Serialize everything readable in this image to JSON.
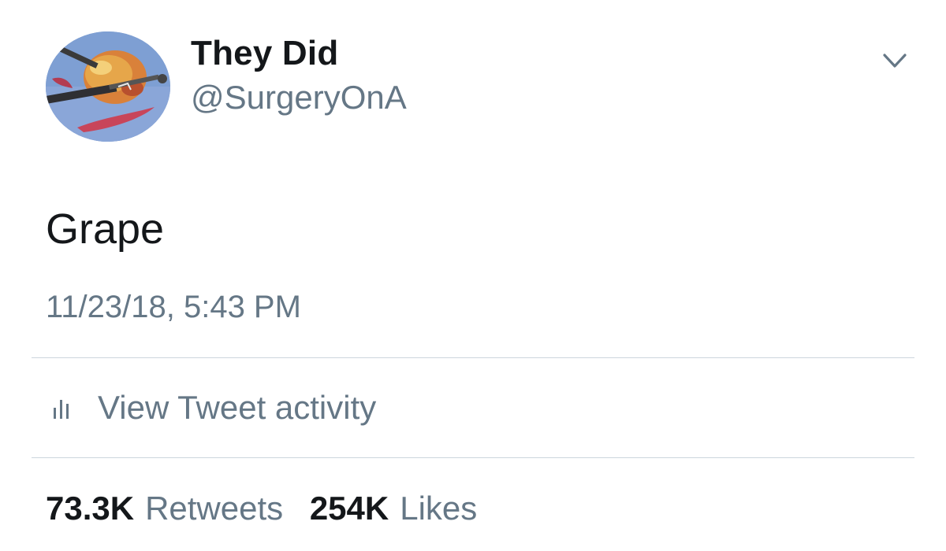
{
  "author": {
    "display_name": "They Did",
    "handle": "@SurgeryOnA"
  },
  "tweet": {
    "text": "Grape",
    "timestamp": "11/23/18, 5:43 PM"
  },
  "activity": {
    "label": "View Tweet activity",
    "icon": "bar-chart-icon"
  },
  "stats": {
    "retweets_count": "73.3K",
    "retweets_label": "Retweets",
    "likes_count": "254K",
    "likes_label": "Likes"
  },
  "colors": {
    "primary_text": "#14171a",
    "secondary_text": "#657786",
    "divider": "#ccd6dd"
  }
}
